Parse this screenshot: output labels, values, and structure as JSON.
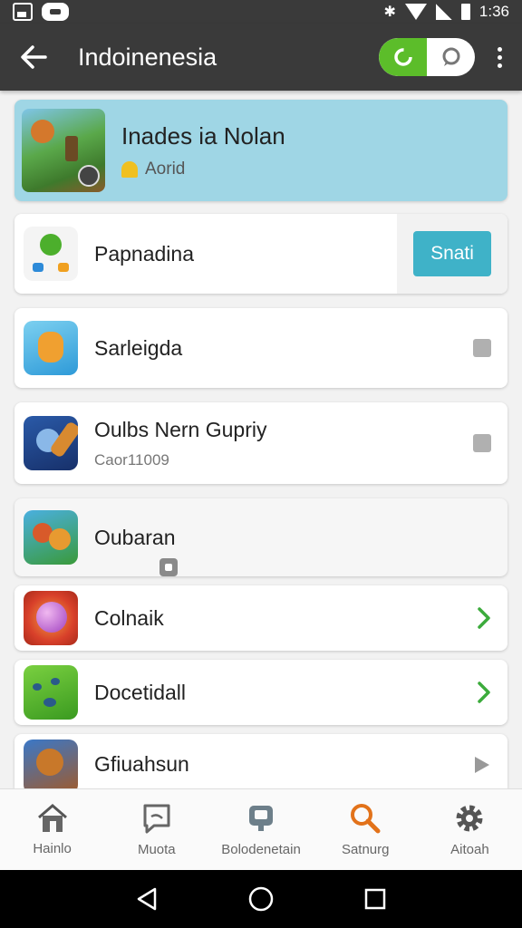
{
  "status_bar": {
    "time": "1:36"
  },
  "app_bar": {
    "title": "Indoinenesia"
  },
  "featured": {
    "title": "Inades ia Nolan",
    "subtitle": "Aorid"
  },
  "items": [
    {
      "title": "Papnadina",
      "action_label": "Snati"
    },
    {
      "title": "Sarleigda"
    },
    {
      "title": "Oulbs Nern Gupriy",
      "subtitle": "Caor11009"
    },
    {
      "title": "Oubaran"
    },
    {
      "title": "Colnaik"
    },
    {
      "title": "Docetidall"
    },
    {
      "title": "Gfiuahsun"
    }
  ],
  "bottom_nav": [
    {
      "label": "Hainlo",
      "icon": "home-icon"
    },
    {
      "label": "Muota",
      "icon": "message-icon"
    },
    {
      "label": "Bolodenetain",
      "icon": "robot-icon"
    },
    {
      "label": "Satnurg",
      "icon": "search-icon"
    },
    {
      "label": "Aitoah",
      "icon": "gear-icon"
    }
  ],
  "colors": {
    "accent_green": "#5cbd2a",
    "accent_teal": "#3fb2c8",
    "featured_bg": "#9fd6e5",
    "bar_dark": "#3a3a3a",
    "search_orange": "#e2721a"
  }
}
